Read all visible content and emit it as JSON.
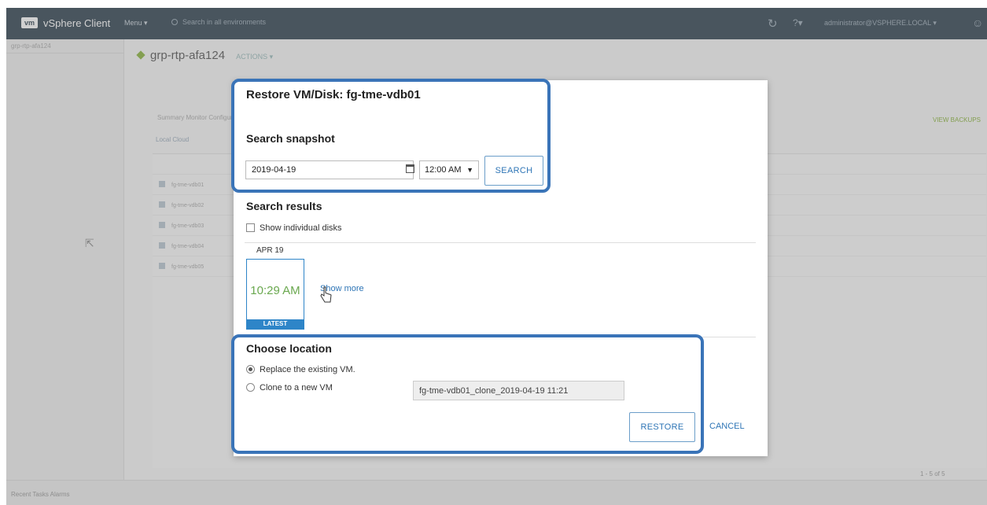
{
  "app": {
    "logo": "vm",
    "title": "vSphere Client",
    "menu": "Menu ▾",
    "search_placeholder": "Search in all environments",
    "user": "administrator@VSPHERE.LOCAL ▾"
  },
  "nav": {
    "crumb": "grp-rtp-afa124"
  },
  "page": {
    "object_name": "grp-rtp-afa124",
    "actions": "ACTIONS ▾",
    "subtabs": "Summary   Monitor   Configure",
    "subtabs2": "Local   Cloud",
    "view_btn": "VIEW BACKUPS",
    "rows": [
      "fg-tme-vdb01",
      "fg-tme-vdb02",
      "fg-tme-vdb03",
      "fg-tme-vdb04",
      "fg-tme-vdb05"
    ],
    "pager": "1 - 5 of 5",
    "recent_tasks": "Recent Tasks   Alarms"
  },
  "dialog": {
    "title": "Restore VM/Disk: fg-tme-vdb01",
    "search_snapshot": {
      "heading": "Search snapshot",
      "date_value": "2019-04-19",
      "time_value": "12:00 AM",
      "search_button": "SEARCH"
    },
    "results": {
      "heading": "Search results",
      "show_individual_disks": "Show individual disks",
      "date_header": "APR 19",
      "snapshot_time": "10:29 AM",
      "latest_badge": "LATEST",
      "show_more": "Show more"
    },
    "location": {
      "heading": "Choose location",
      "replace_label": "Replace the existing VM.",
      "clone_label": "Clone to a new VM",
      "clone_name_value": "fg-tme-vdb01_clone_2019-04-19 11:21",
      "selected": "replace"
    },
    "buttons": {
      "restore": "RESTORE",
      "cancel": "CANCEL"
    }
  },
  "colors": {
    "highlight": "#3a74b8",
    "accent_blue": "#2e75b6",
    "snapshot_green": "#6aa84f",
    "topbar": "#314351"
  }
}
